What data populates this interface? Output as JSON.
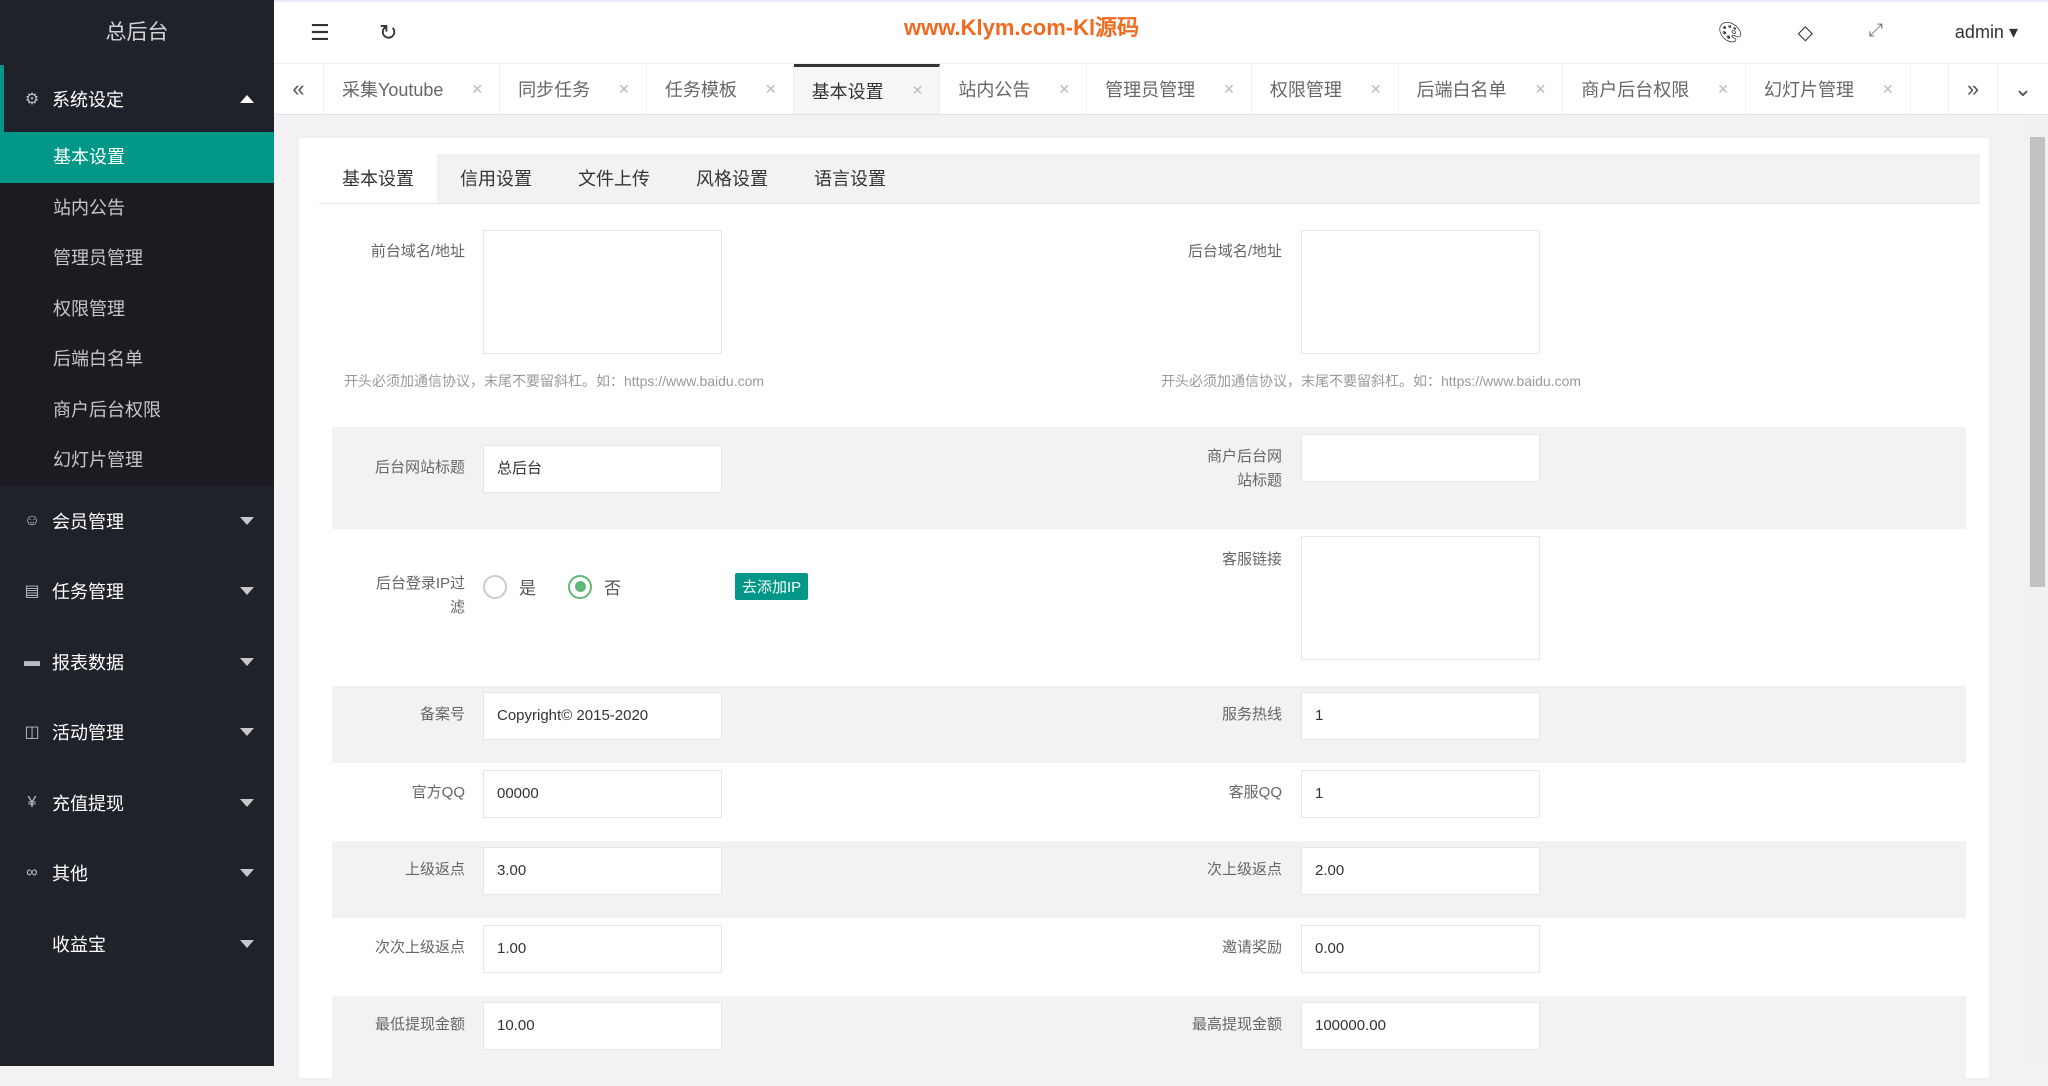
{
  "sidebar": {
    "title": "总后台",
    "open_group": "系统设定",
    "sub_items": [
      "基本设置",
      "站内公告",
      "管理员管理",
      "权限管理",
      "后端白名单",
      "商户后台权限",
      "幻灯片管理"
    ],
    "groups": [
      {
        "label": "会员管理",
        "icon": "user-icon"
      },
      {
        "label": "任务管理",
        "icon": "doc-icon"
      },
      {
        "label": "报表数据",
        "icon": "chat-icon"
      },
      {
        "label": "活动管理",
        "icon": "book-icon"
      },
      {
        "label": "充值提现",
        "icon": "yen-icon"
      },
      {
        "label": "其他",
        "icon": "infinity-icon"
      },
      {
        "label": "收益宝",
        "icon": ""
      }
    ]
  },
  "header": {
    "watermark": "www.Klym.com-Kl源码",
    "user": "admin"
  },
  "tabs": [
    "采集Youtube",
    "同步任务",
    "任务模板",
    "基本设置",
    "站内公告",
    "管理员管理",
    "权限管理",
    "后端白名单",
    "商户后台权限",
    "幻灯片管理"
  ],
  "inner_tabs": [
    "基本设置",
    "信用设置",
    "文件上传",
    "风格设置",
    "语言设置"
  ],
  "form": {
    "front_domain_label": "前台域名/地址",
    "back_domain_label": "后台域名/地址",
    "domain_help": "开头必须加通信协议，末尾不要留斜杠。如：https://www.baidu.com",
    "site_title_label": "后台网站标题",
    "site_title": "总后台",
    "merchant_title_label": "商户后台网站标题",
    "merchant_title": "",
    "ip_filter_label": "后台登录IP过滤",
    "ip_yes": "是",
    "ip_no": "否",
    "ip_selected": "否",
    "add_ip": "去添加IP",
    "service_link_label": "客服链接",
    "icp_label": "备案号",
    "icp": "Copyright© 2015-2020",
    "hotline_label": "服务热线",
    "hotline": "1",
    "qq_label": "官方QQ",
    "qq": "00000",
    "service_qq_label": "客服QQ",
    "service_qq": "1",
    "rebate1_label": "上级返点",
    "rebate1": "3.00",
    "rebate2_label": "次上级返点",
    "rebate2": "2.00",
    "rebate3_label": "次次上级返点",
    "rebate3": "1.00",
    "invite_label": "邀请奖励",
    "invite": "0.00",
    "min_withdraw_label": "最低提现金额",
    "min_withdraw": "10.00",
    "max_withdraw_label": "最高提现金额",
    "max_withdraw": "100000.00"
  }
}
